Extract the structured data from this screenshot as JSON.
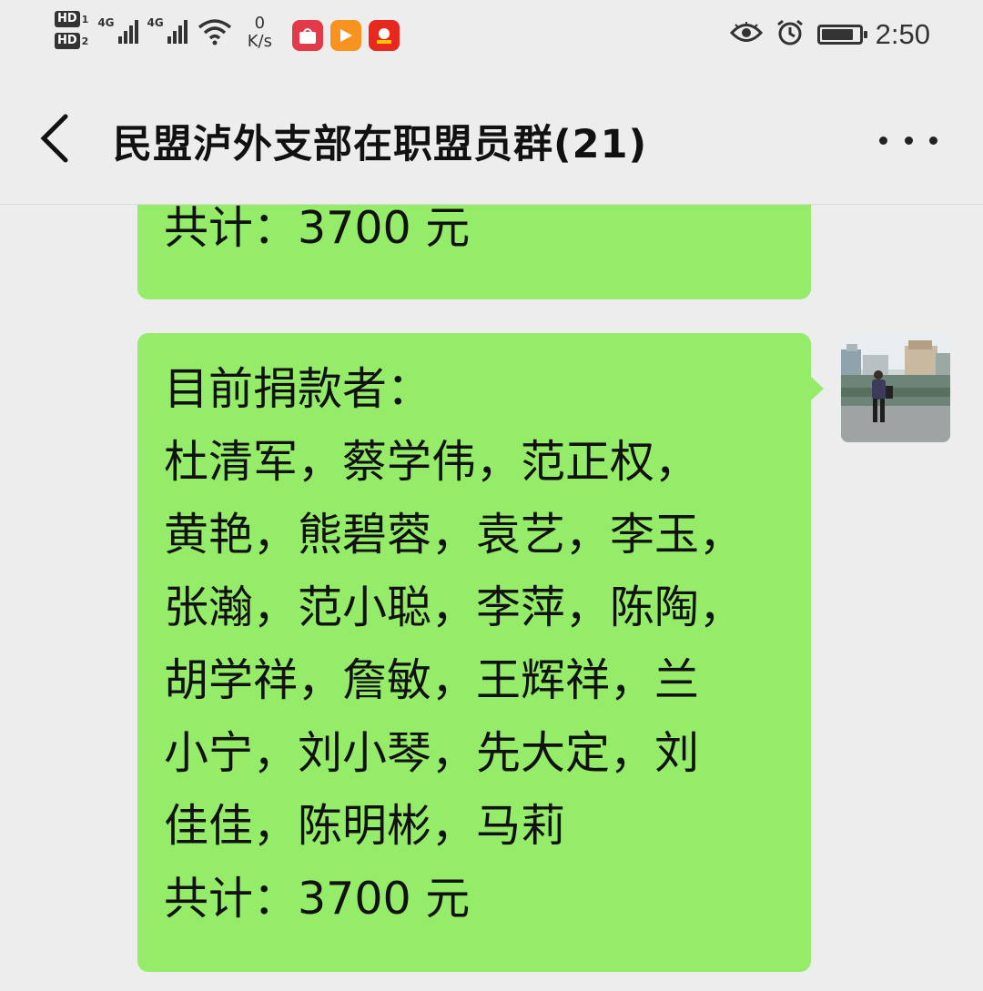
{
  "status_bar": {
    "sim1": "HD",
    "sim1_index": "1",
    "sim2": "HD",
    "sim2_index": "2",
    "net1": "4G",
    "net2": "4G",
    "speed_value": "0",
    "speed_unit": "K/s",
    "time": "2:50",
    "battery_level": 0.9,
    "icons": [
      "eye-comfort-icon",
      "alarm-icon",
      "battery-icon"
    ]
  },
  "header": {
    "title": "民盟泸外支部在职盟员群(21)"
  },
  "messages": [
    {
      "lines": [
        "共计：3700 元"
      ]
    },
    {
      "lines": [
        "目前捐款者：",
        "杜清军，蔡学伟，范正权，",
        "黄艳，熊碧蓉，袁艺，李玉，",
        "张瀚，范小聪，李萍，陈陶，",
        "胡学祥，詹敏，王辉祥，兰",
        "小宁，刘小琴，先大定，刘",
        "佳佳，陈明彬，马莉",
        "共计：3700 元"
      ]
    }
  ],
  "colors": {
    "background": "#ededed",
    "bubble": "#95ec69"
  }
}
